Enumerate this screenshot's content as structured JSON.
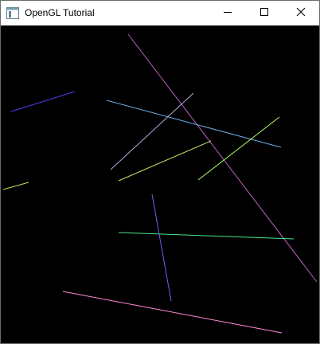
{
  "window": {
    "title": "OpenGL Tutorial",
    "app_icon": "opengl-app-icon",
    "controls": {
      "minimize_icon": "minimize-icon",
      "maximize_icon": "maximize-icon",
      "close_icon": "close-icon"
    }
  },
  "canvas": {
    "background": "#000000",
    "lines_colors": [
      "#c061c0",
      "#5a6ae0",
      "#4a3ee8",
      "#c8e060",
      "#6aaee8",
      "#b0a8e0",
      "#9ff47c",
      "#b0ff60",
      "#7a5af2",
      "#4ae88a",
      "#ff8ad8"
    ]
  }
}
